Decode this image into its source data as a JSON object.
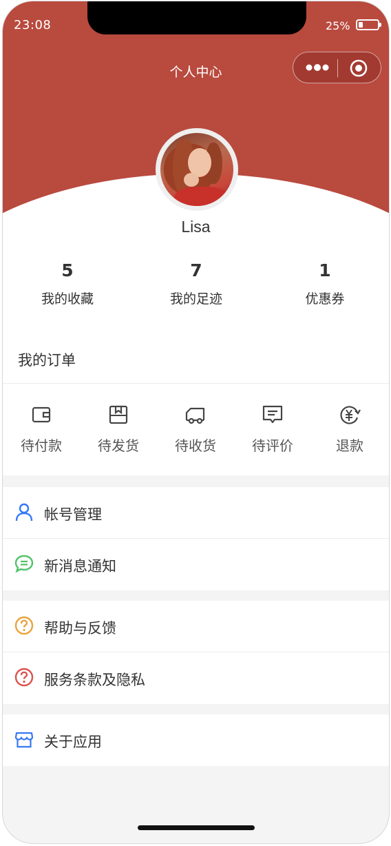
{
  "status_bar": {
    "time": "23:08",
    "battery": "25%"
  },
  "nav": {
    "title": "个人中心",
    "more_icon": "more-dots-icon",
    "close_icon": "target-icon"
  },
  "colors": {
    "brand": "#b94a3e",
    "account_icon": "#3478f6",
    "message_icon": "#52c26b",
    "help_icon": "#e8a33c",
    "terms_icon": "#d9534f",
    "about_icon": "#3478f6"
  },
  "profile": {
    "username": "Lisa"
  },
  "stats": [
    {
      "value": "5",
      "label": "我的收藏"
    },
    {
      "value": "7",
      "label": "我的足迹"
    },
    {
      "value": "1",
      "label": "优惠券"
    }
  ],
  "orders": {
    "title": "我的订单",
    "items": [
      {
        "label": "待付款",
        "icon": "wallet-icon"
      },
      {
        "label": "待发货",
        "icon": "box-icon"
      },
      {
        "label": "待收货",
        "icon": "truck-icon"
      },
      {
        "label": "待评价",
        "icon": "comment-icon"
      },
      {
        "label": "退款",
        "icon": "refund-icon"
      }
    ]
  },
  "menu": {
    "group1": [
      {
        "label": "帐号管理",
        "icon": "user-icon"
      },
      {
        "label": "新消息通知",
        "icon": "message-icon"
      }
    ],
    "group2": [
      {
        "label": "帮助与反馈",
        "icon": "help-icon"
      },
      {
        "label": "服务条款及隐私",
        "icon": "terms-icon"
      }
    ],
    "group3": [
      {
        "label": "关于应用",
        "icon": "store-icon"
      }
    ]
  }
}
